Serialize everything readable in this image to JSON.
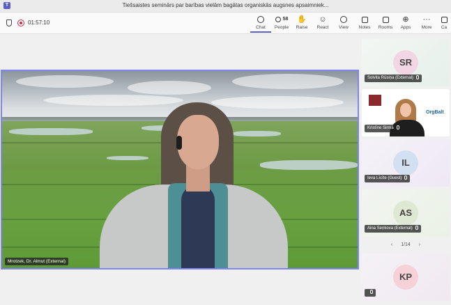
{
  "window": {
    "title": "Tiešsaistes seminārs par barības vielām bagātas organiskās augsnes apsaimniek..."
  },
  "toolbar": {
    "timer": "01:57:10",
    "buttons": [
      {
        "label": "Chat",
        "icon": "chat-icon"
      },
      {
        "label": "People",
        "icon": "people-icon",
        "count": "58"
      },
      {
        "label": "Raise",
        "icon": "raise-hand-icon"
      },
      {
        "label": "React",
        "icon": "react-icon"
      },
      {
        "label": "View",
        "icon": "view-icon"
      },
      {
        "label": "Notes",
        "icon": "notes-icon"
      },
      {
        "label": "Rooms",
        "icon": "rooms-icon"
      },
      {
        "label": "Apps",
        "icon": "apps-icon"
      },
      {
        "label": "More",
        "icon": "more-icon"
      },
      {
        "label": "Ca",
        "icon": "camera-icon"
      }
    ]
  },
  "stage": {
    "speaker_name": "Mrotzek, Dr. Almut (External)"
  },
  "participants": [
    {
      "initials": "SR",
      "name": "Solvita Rūsiņa (External)",
      "avatar_color": "#f3d6e4"
    },
    {
      "initials": "",
      "name": "Kristīne Sirmā",
      "avatar_color": ""
    },
    {
      "initials": "IL",
      "name": "Ieva Līcīte (Guest)",
      "avatar_color": "#d3e0f1"
    },
    {
      "initials": "AS",
      "name": "Aina Seņkova (External)",
      "avatar_color": "#dfe8d3"
    },
    {
      "initials": "KP",
      "name": "",
      "avatar_color": "#f6d2d8"
    }
  ],
  "pager": {
    "text": "1/14",
    "prev": "‹",
    "next": "›"
  },
  "logo_text": "OrgBalt"
}
